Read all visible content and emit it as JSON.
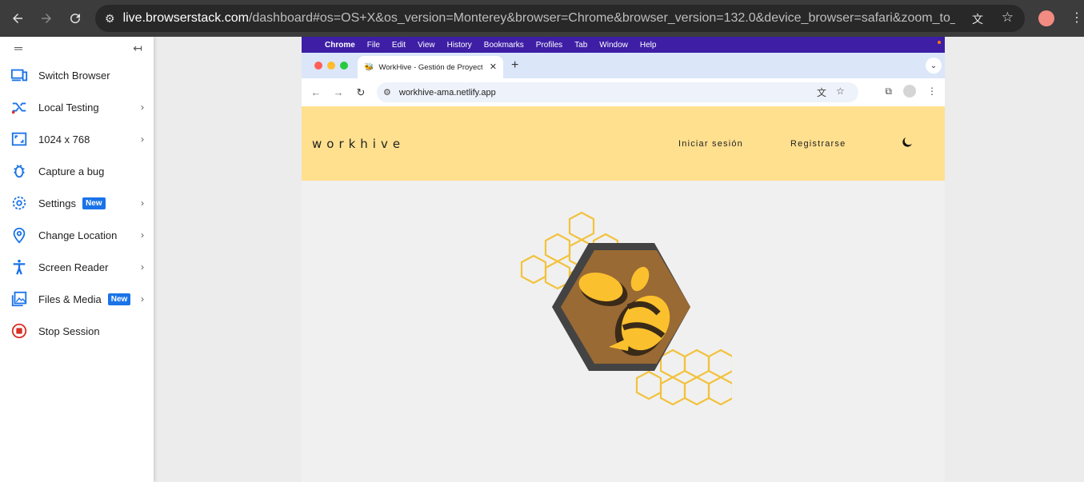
{
  "outer_browser": {
    "url_host": "live.browserstack.com",
    "url_path": "/dashboard#os=OS+X&os_version=Monterey&browser=Chrome&browser_version=132.0&device_browser=safari&zoom_to_fit=true&full_scre..."
  },
  "sidebar": {
    "items": [
      {
        "label": "Switch Browser",
        "icon": "switch-browser-icon",
        "chevron": false
      },
      {
        "label": "Local Testing",
        "icon": "local-testing-icon",
        "chevron": true
      },
      {
        "label": "1024 x 768",
        "icon": "resolution-icon",
        "chevron": true
      },
      {
        "label": "Capture a bug",
        "icon": "bug-icon",
        "chevron": false
      },
      {
        "label": "Settings",
        "icon": "gear-icon",
        "chevron": true,
        "badge": "New"
      },
      {
        "label": "Change Location",
        "icon": "location-pin-icon",
        "chevron": true
      },
      {
        "label": "Screen Reader",
        "icon": "accessibility-icon",
        "chevron": true
      },
      {
        "label": "Files & Media",
        "icon": "media-icon",
        "chevron": true,
        "badge": "New"
      },
      {
        "label": "Stop Session",
        "icon": "stop-icon",
        "chevron": false
      }
    ]
  },
  "remote": {
    "menubar": {
      "app": "Chrome",
      "items": [
        "File",
        "Edit",
        "View",
        "History",
        "Bookmarks",
        "Profiles",
        "Tab",
        "Window",
        "Help"
      ]
    },
    "tab": {
      "title": "WorkHive - Gestión de Proyectos"
    },
    "address": "workhive-ama.netlify.app",
    "site": {
      "logo": "workhive",
      "nav_login": "Iniciar sesión",
      "nav_register": "Registrarse"
    }
  },
  "colors": {
    "accent_blue": "#1a73e8",
    "header_yellow": "#ffe08f",
    "mac_menubar": "#3d1ea5",
    "stop_red": "#d93025"
  }
}
